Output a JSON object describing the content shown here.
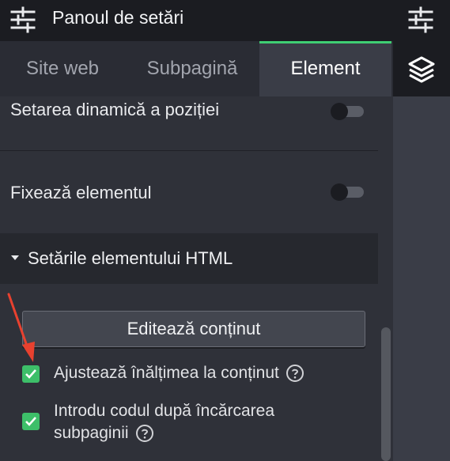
{
  "header": {
    "title": "Panoul de setări",
    "icon": "sliders-icon"
  },
  "tabs": [
    {
      "label": "Site web",
      "active": false
    },
    {
      "label": "Subpagină",
      "active": false
    },
    {
      "label": "Element",
      "active": true
    }
  ],
  "right_icons": [
    "sliders-icon",
    "layers-icon"
  ],
  "settings": {
    "dynamic_position": {
      "label": "Setarea dinamică a poziției",
      "enabled": false
    },
    "pin_element": {
      "label": "Fixează elementul",
      "enabled": false
    }
  },
  "html_section": {
    "title": "Setările elementului HTML",
    "edit_button": "Editează conținut",
    "options": [
      {
        "label": "Ajustează înălțimea la conținut",
        "checked": true
      },
      {
        "label_line1": "Introdu codul după încărcarea",
        "label_line2": "subpaginii",
        "checked": true
      }
    ]
  },
  "colors": {
    "accent": "#3fcf73",
    "checkbox": "#3dbf69",
    "annotation": "#e8412f"
  }
}
